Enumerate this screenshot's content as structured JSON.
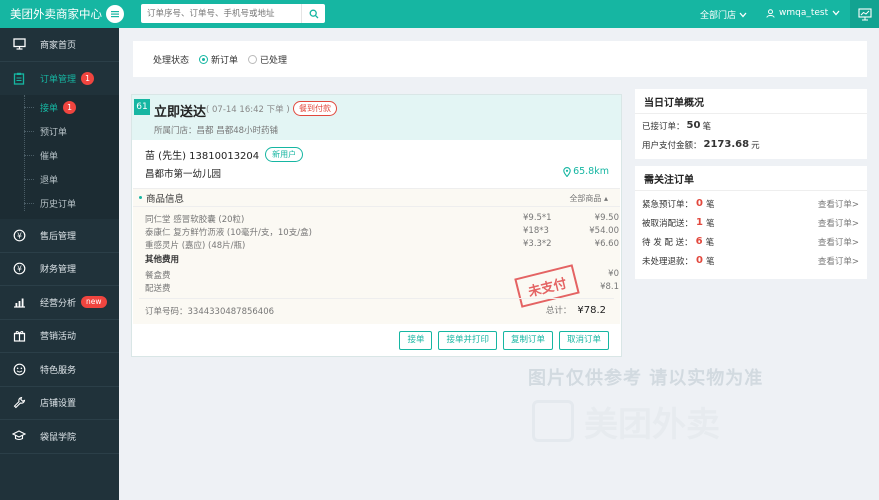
{
  "header": {
    "brand": "美团外卖商家中心",
    "search_placeholder": "订单序号、订单号、手机号或地址",
    "store": "全部门店",
    "user": "wmqa_test"
  },
  "sidebar": {
    "items": [
      {
        "label": "商家首页",
        "icon": "monitor-icon"
      },
      {
        "label": "订单管理",
        "icon": "clipboard-icon",
        "badge": "1"
      },
      {
        "label": "售后管理",
        "icon": "yen-circle-icon"
      },
      {
        "label": "财务管理",
        "icon": "yen-circle-icon"
      },
      {
        "label": "经营分析",
        "icon": "chart-icon",
        "badge": "new"
      },
      {
        "label": "营销活动",
        "icon": "gift-icon"
      },
      {
        "label": "特色服务",
        "icon": "smile-icon"
      },
      {
        "label": "店铺设置",
        "icon": "wrench-icon"
      },
      {
        "label": "袋鼠学院",
        "icon": "graduation-cap-icon"
      }
    ],
    "sub_items": [
      {
        "label": "接单",
        "badge": "1"
      },
      {
        "label": "预订单"
      },
      {
        "label": "催单"
      },
      {
        "label": "退单"
      },
      {
        "label": "历史订单"
      }
    ]
  },
  "filter": {
    "label": "处理状态",
    "options": [
      "新订单",
      "已处理"
    ],
    "selected": "新订单"
  },
  "order": {
    "number": "61",
    "title": "立即送达",
    "time": "( 07-14 16:42 下单 )",
    "pay_tag": "餐到付款",
    "store": "所属门店：昌都 昌都48小时药铺",
    "customer": "苗 (先生) 13810013204",
    "customer_tag": "新用户",
    "address": "昌都市第一幼儿园",
    "distance": "65.8km",
    "goods_header": "商品信息",
    "all_goods": "全部商品",
    "items": [
      {
        "name": "同仁堂 感冒软胶囊 (20粒)",
        "qty": "¥9.5*1",
        "price": "¥9.50"
      },
      {
        "name": "泰康仁 复方鲜竹沥液 (10毫升/支，10支/盒)",
        "qty": "¥18*3",
        "price": "¥54.00"
      },
      {
        "name": "重感灵片 (嘉应) (48片/瓶)",
        "qty": "¥3.3*2",
        "price": "¥6.60"
      }
    ],
    "other_fees_label": "其他费用",
    "fees": [
      {
        "name": "餐盒费",
        "price": "¥0"
      },
      {
        "name": "配送费",
        "price": "¥8.1"
      }
    ],
    "order_no": "订单号码：3344330487856406",
    "total_label": "总计：",
    "total": "¥78.2",
    "stamp": "未支付",
    "buttons": [
      "接单",
      "接单并打印",
      "复制订单",
      "取消订单"
    ]
  },
  "summary": {
    "title": "当日订单概况",
    "received_label": "已接订单：",
    "received": "50",
    "received_unit": "笔",
    "amount_label": "用户支付金额：",
    "amount": "2173.68",
    "amount_unit": "元"
  },
  "attention": {
    "title": "需关注订单",
    "rows": [
      {
        "label": "紧急预订单：",
        "count": "0",
        "unit": "笔",
        "link": "查看订单>"
      },
      {
        "label": "被取消配送：",
        "count": "1",
        "unit": "笔",
        "link": "查看订单>"
      },
      {
        "label": "待 发 配 送：",
        "count": "6",
        "unit": "笔",
        "link": "查看订单>"
      },
      {
        "label": "未处理退款：",
        "count": "0",
        "unit": "笔",
        "link": "查看订单>"
      }
    ]
  },
  "watermark": {
    "text": "图片仅供参考 请以实物为准",
    "logo": "美团外卖"
  },
  "colors": {
    "accent": "#16b6a2",
    "sidebar": "#20323a",
    "alert": "#f0453f"
  }
}
